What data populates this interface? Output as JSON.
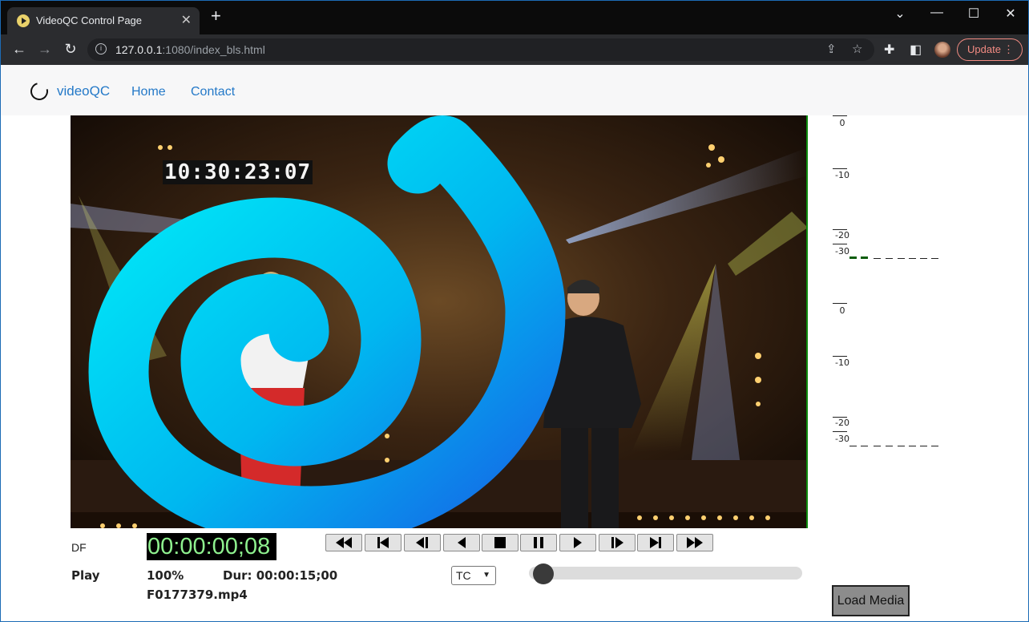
{
  "browser": {
    "tab_title": "VideoQC Control Page",
    "tab_close": "✕",
    "new_tab": "+",
    "url_host": "127.0.0.1",
    "url_rest": ":1080/index_bls.html",
    "update_label": "Update",
    "window_controls": [
      "⌄",
      "—",
      "☐",
      "✕"
    ]
  },
  "navbar": {
    "brand": "videoQC",
    "links": [
      "Home",
      "Contact"
    ]
  },
  "video": {
    "burned_timecode": "10:30:23:07"
  },
  "meters": {
    "top": {
      "labels": [
        "0",
        "-10",
        "-20",
        "-30"
      ]
    },
    "bottom": {
      "labels": [
        "0",
        "-10",
        "-20",
        "-30"
      ]
    }
  },
  "controls": {
    "df_label": "DF",
    "timecode": "00:00:00;08",
    "state": "Play",
    "speed": "100%",
    "duration": "Dur: 00:00:15;00",
    "filename": "F0177379.mp4",
    "mode_select": "TC",
    "position_fraction": 0.01,
    "load_button": "Load Media"
  },
  "icons": {
    "transport": [
      "fast-rewind-icon",
      "skip-start-icon",
      "step-back-icon",
      "reverse-play-icon",
      "stop-icon",
      "pause-icon",
      "play-icon",
      "step-forward-icon",
      "skip-end-icon",
      "fast-forward-icon"
    ]
  },
  "colors": {
    "timecode_fg": "#8ef08e",
    "link": "#2479c8",
    "spiral_outer": "#00e5f5",
    "spiral_inner": "#1565e6"
  }
}
